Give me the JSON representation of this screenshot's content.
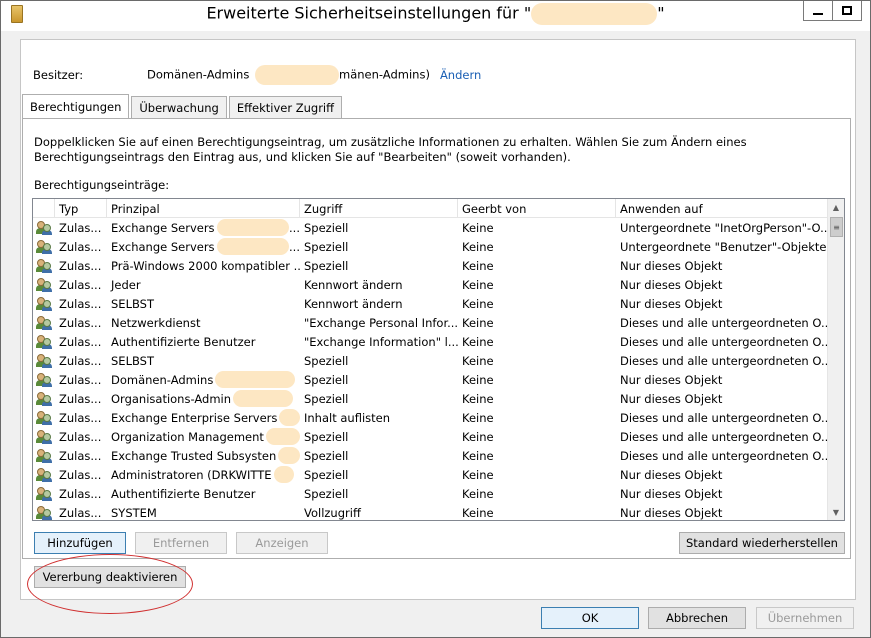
{
  "window": {
    "title_prefix": "Erweiterte Sicherheitseinstellungen für \"",
    "title_suffix": "\""
  },
  "owner": {
    "label": "Besitzer:",
    "value_prefix": "Domänen-Admins",
    "value_suffix": "mänen-Admins)",
    "change_link": "Ändern"
  },
  "tabs": [
    {
      "label": "Berechtigungen",
      "active": true
    },
    {
      "label": "Überwachung",
      "active": false
    },
    {
      "label": "Effektiver Zugriff",
      "active": false
    }
  ],
  "description": "Doppelklicken Sie auf einen Berechtigungseintrag, um zusätzliche Informationen zu erhalten. Wählen Sie zum Ändern eines Berechtigungseintrags den Eintrag aus, und klicken Sie auf \"Bearbeiten\" (soweit vorhanden).",
  "entries_label": "Berechtigungseinträge:",
  "columns": [
    "Typ",
    "Prinzipal",
    "Zugriff",
    "Geerbt von",
    "Anwenden auf"
  ],
  "rows": [
    {
      "typ": "Zulas...",
      "prinzipal": "Exchange Servers",
      "prinzipal_tail": "...",
      "zugriff": "Speziell",
      "geerbt": "Keine",
      "anwenden": "Untergeordnete \"InetOrgPerson\"-O..."
    },
    {
      "typ": "Zulas...",
      "prinzipal": "Exchange Servers",
      "prinzipal_tail": "...",
      "zugriff": "Speziell",
      "geerbt": "Keine",
      "anwenden": "Untergeordnete \"Benutzer\"-Objekte"
    },
    {
      "typ": "Zulas...",
      "prinzipal": "Prä-Windows 2000 kompatibler ...",
      "prinzipal_tail": "",
      "zugriff": "Speziell",
      "geerbt": "Keine",
      "anwenden": "Nur dieses Objekt"
    },
    {
      "typ": "Zulas...",
      "prinzipal": "Jeder",
      "prinzipal_tail": "",
      "zugriff": "Kennwort ändern",
      "geerbt": "Keine",
      "anwenden": "Nur dieses Objekt"
    },
    {
      "typ": "Zulas...",
      "prinzipal": "SELBST",
      "prinzipal_tail": "",
      "zugriff": "Kennwort ändern",
      "geerbt": "Keine",
      "anwenden": "Nur dieses Objekt"
    },
    {
      "typ": "Zulas...",
      "prinzipal": "Netzwerkdienst",
      "prinzipal_tail": "",
      "zugriff": "\"Exchange Personal Infor...",
      "geerbt": "Keine",
      "anwenden": "Dieses und alle untergeordneten O..."
    },
    {
      "typ": "Zulas...",
      "prinzipal": "Authentifizierte Benutzer",
      "prinzipal_tail": "",
      "zugriff": "\"Exchange Information\" l...",
      "geerbt": "Keine",
      "anwenden": "Dieses und alle untergeordneten O..."
    },
    {
      "typ": "Zulas...",
      "prinzipal": "SELBST",
      "prinzipal_tail": "",
      "zugriff": "Speziell",
      "geerbt": "Keine",
      "anwenden": "Dieses und alle untergeordneten O..."
    },
    {
      "typ": "Zulas...",
      "prinzipal": "Domänen-Admins",
      "prinzipal_tail": "",
      "zugriff": "Speziell",
      "geerbt": "Keine",
      "anwenden": "Nur dieses Objekt"
    },
    {
      "typ": "Zulas...",
      "prinzipal": "Organisations-Admin",
      "prinzipal_tail": "",
      "zugriff": "Speziell",
      "geerbt": "Keine",
      "anwenden": "Nur dieses Objekt"
    },
    {
      "typ": "Zulas...",
      "prinzipal": "Exchange Enterprise Servers",
      "prinzipal_tail": "",
      "zugriff": "Inhalt auflisten",
      "geerbt": "Keine",
      "anwenden": "Dieses und alle untergeordneten O..."
    },
    {
      "typ": "Zulas...",
      "prinzipal": "Organization Management",
      "prinzipal_tail": "",
      "zugriff": "Speziell",
      "geerbt": "Keine",
      "anwenden": "Dieses und alle untergeordneten O..."
    },
    {
      "typ": "Zulas...",
      "prinzipal": "Exchange Trusted Subsysten",
      "prinzipal_tail": "",
      "zugriff": "Speziell",
      "geerbt": "Keine",
      "anwenden": "Dieses und alle untergeordneten O..."
    },
    {
      "typ": "Zulas...",
      "prinzipal": "Administratoren (DRKWITTE",
      "prinzipal_tail": "",
      "zugriff": "Speziell",
      "geerbt": "Keine",
      "anwenden": "Nur dieses Objekt"
    },
    {
      "typ": "Zulas...",
      "prinzipal": "Authentifizierte Benutzer",
      "prinzipal_tail": "",
      "zugriff": "Speziell",
      "geerbt": "Keine",
      "anwenden": "Nur dieses Objekt"
    },
    {
      "typ": "Zulas...",
      "prinzipal": "SYSTEM",
      "prinzipal_tail": "",
      "zugriff": "Vollzugriff",
      "geerbt": "Keine",
      "anwenden": "Nur dieses Objekt"
    }
  ],
  "buttons": {
    "add": "Hinzufügen",
    "remove": "Entfernen",
    "view": "Anzeigen",
    "restore_defaults": "Standard wiederherstellen",
    "disable_inheritance": "Vererbung deaktivieren",
    "ok": "OK",
    "cancel": "Abbrechen",
    "apply": "Übernehmen"
  },
  "colors": {
    "annotation": "#d03030",
    "redaction": "#fde7c3",
    "link": "#1a5fb4"
  }
}
